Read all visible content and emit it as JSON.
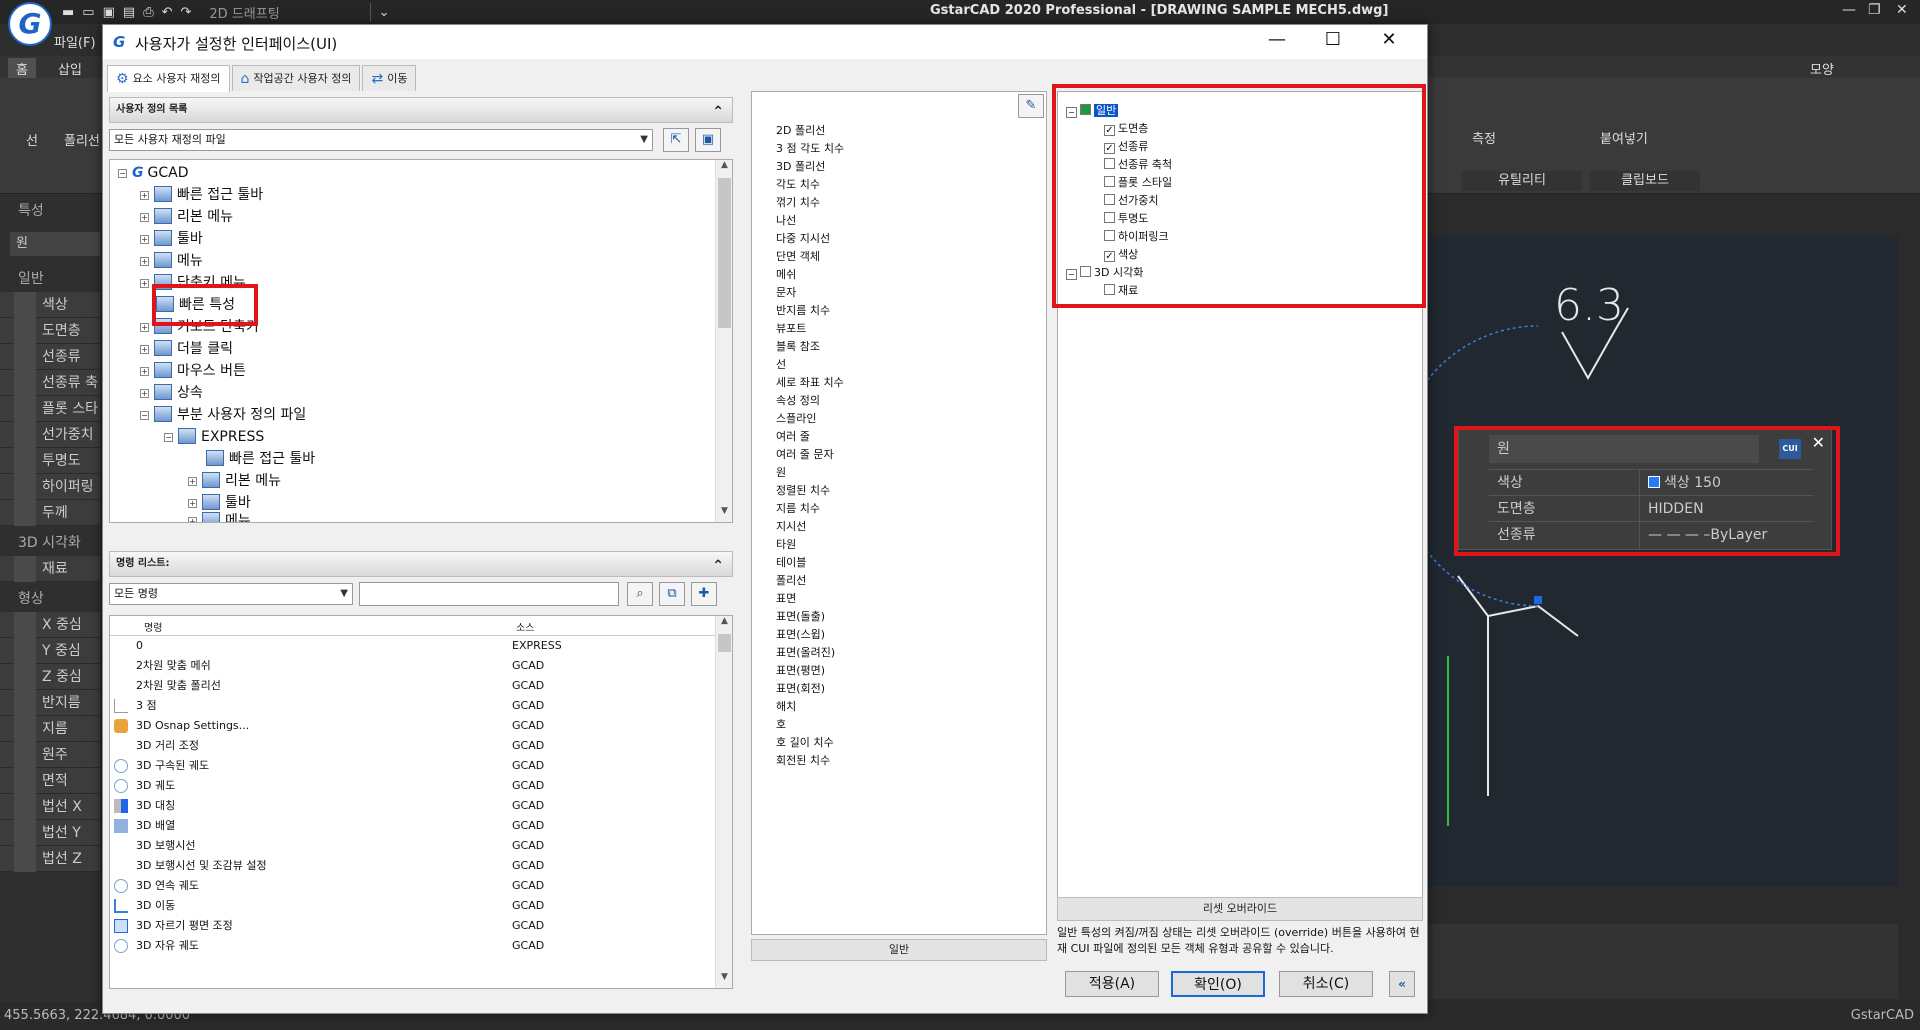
{
  "app": {
    "logo": "G",
    "workspace": "2D 드래프팅",
    "title": "GstarCAD 2020 Professional - [DRAWING SAMPLE MECH5.dwg]",
    "menu_file": "파일(F)",
    "tab_home": "홈",
    "tab_insert": "삽입",
    "ribbon_line": "선",
    "ribbon_polyline": "폴리선",
    "ribbon_measure": "측정",
    "ribbon_paste": "붙여넣기",
    "group_utility": "유틸리티",
    "group_clipboard": "클립보드",
    "shape_menu": "모양",
    "status_coords": "455.5663, 222.4684, 0.0000",
    "status_app": "GstarCAD"
  },
  "left_panel": {
    "title": "특성",
    "combo": "원",
    "sec_general": "일반",
    "items_general": [
      "색상",
      "도면층",
      "선종류",
      "선종류 축",
      "플롯 스타",
      "선가중치",
      "투명도",
      "하이퍼링",
      "두께"
    ],
    "sec_3d": "3D 시각화",
    "items_3d": [
      "재료"
    ],
    "sec_geom": "형상",
    "items_geom": [
      "X 중심",
      "Y 중심",
      "Z 중심",
      "반지름",
      "지름",
      "원주",
      "면적",
      "법선 X",
      "법선 Y",
      "법선 Z"
    ]
  },
  "drawing": {
    "annotation": "6.3"
  },
  "quick_props": {
    "object": "원",
    "cui_label": "CUI",
    "rows": [
      {
        "key": "색상",
        "value": "색상 150"
      },
      {
        "key": "도면층",
        "value": "HIDDEN"
      },
      {
        "key": "선종류",
        "value": "— — — –ByLayer"
      }
    ],
    "swatch_color": "#1e7dff"
  },
  "dialog": {
    "icon": "G",
    "title": "사용자가 설정한 인터페이스(UI)",
    "tabs": [
      "요소 사용자 재정의",
      "작업공간 사용자 정의",
      "이동"
    ],
    "custom_list_header": "사용자 정의 목록",
    "custom_file_combo": "모든 사용자 재정의 파일",
    "tree": {
      "root": "GCAD",
      "items": [
        "빠른 접근 툴바",
        "리본 메뉴",
        "툴바",
        "메뉴",
        "단축키 메뉴",
        "빠른 특성",
        "키보드 단축키",
        "더블 클릭",
        "마우스 버튼",
        "상속",
        "부분 사용자 정의 파일"
      ],
      "express": "EXPRESS",
      "express_items": [
        "빠른 접근 툴바",
        "리본 메뉴",
        "툴바",
        "메뉴"
      ]
    },
    "command_list_header": "명령 리스트:",
    "command_combo": "모든 명령",
    "command_columns": {
      "name": "명령",
      "source": "소스"
    },
    "commands": [
      {
        "name": "0",
        "source": "EXPRESS"
      },
      {
        "name": "2차원 맞춤 메쉬",
        "source": "GCAD"
      },
      {
        "name": "2차원 맞춤 폴리선",
        "source": "GCAD"
      },
      {
        "name": "3 점",
        "source": "GCAD"
      },
      {
        "name": "3D Osnap Settings...",
        "source": "GCAD"
      },
      {
        "name": "3D 거리 조정",
        "source": "GCAD"
      },
      {
        "name": "3D 구속된 궤도",
        "source": "GCAD"
      },
      {
        "name": "3D 궤도",
        "source": "GCAD"
      },
      {
        "name": "3D 대칭",
        "source": "GCAD"
      },
      {
        "name": "3D 배열",
        "source": "GCAD"
      },
      {
        "name": "3D 보행시선",
        "source": "GCAD"
      },
      {
        "name": "3D 보행시선 및 조감뷰 설정",
        "source": "GCAD"
      },
      {
        "name": "3D 연속 궤도",
        "source": "GCAD"
      },
      {
        "name": "3D 이동",
        "source": "GCAD"
      },
      {
        "name": "3D 자르기 평면 조정",
        "source": "GCAD"
      },
      {
        "name": "3D 자유 궤도",
        "source": "GCAD"
      }
    ],
    "object_types": [
      "2D 폴리선",
      "3 점 각도 치수",
      "3D 폴리선",
      "각도 치수",
      "꺾기 치수",
      "나선",
      "다중 지시선",
      "단면 객체",
      "메쉬",
      "문자",
      "반지름 치수",
      "뷰포트",
      "블록 참조",
      "선",
      "세로 좌표 치수",
      "속성 정의",
      "스플라인",
      "여러 줄",
      "여러 줄 문자",
      "원",
      "정렬된 치수",
      "지름 치수",
      "지시선",
      "타원",
      "테이블",
      "폴리선",
      "표면",
      "표면(돌출)",
      "표면(스윕)",
      "표면(올려진)",
      "표면(평면)",
      "표면(회전)",
      "해치",
      "호",
      "호 길이 치수",
      "회전된 치수"
    ],
    "object_footer": "일반",
    "properties": {
      "general": "일반",
      "general_items": [
        {
          "label": "도면층",
          "checked": true
        },
        {
          "label": "선종류",
          "checked": true
        },
        {
          "label": "선종류 축척",
          "checked": false
        },
        {
          "label": "플롯 스타일",
          "checked": false
        },
        {
          "label": "선가중치",
          "checked": false
        },
        {
          "label": "투명도",
          "checked": false
        },
        {
          "label": "하이퍼링크",
          "checked": false
        },
        {
          "label": "색상",
          "checked": true
        }
      ],
      "viz3d": "3D 시각화",
      "viz3d_items": [
        {
          "label": "재료",
          "checked": false
        }
      ]
    },
    "reset_override": "리셋 오버라이드",
    "description": "일반 특성의 켜짐/꺼짐 상태는 리셋 오버라이드 (override) 버튼을 사용하여 현재 CUI 파일에 정의된 모든 객체 유형과 공유할 수 있습니다.",
    "btn_apply": "적용(A)",
    "btn_ok": "확인(O)",
    "btn_cancel": "취소(C)"
  }
}
